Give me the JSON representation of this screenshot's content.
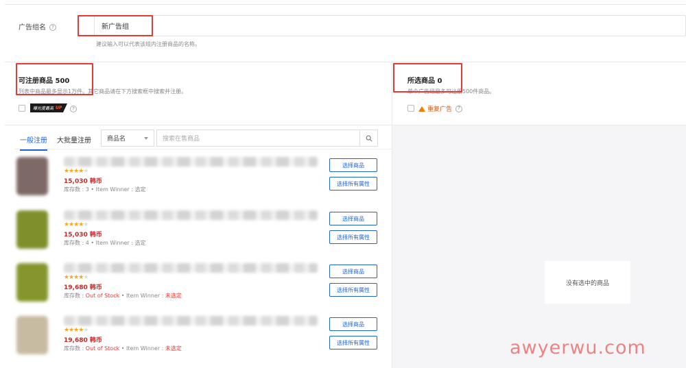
{
  "group": {
    "label": "广告组名",
    "help": "?",
    "value": "新广告组",
    "hint": "建议输入可以代表该组内注册商品的名称。"
  },
  "available": {
    "title": "可注册商品 500",
    "subtitle": "列表中商品最多显示1万件。其它商品请在下方搜索框中搜索并注册。",
    "badge_text": "曝光度最高",
    "badge_up": "UP",
    "help": "?"
  },
  "selected": {
    "title": "所选商品 0",
    "subtitle": "单个广告组最多可注册500件商品。",
    "warning": "重复广告",
    "help": "?",
    "empty_text": "没有选中的商品"
  },
  "tabs": {
    "general": "一般注册",
    "bulk": "大批量注册"
  },
  "search": {
    "select_value": "商品名",
    "placeholder": "搜索在售商品"
  },
  "buttons": {
    "select": "选择商品",
    "select_all": "选择所有属性"
  },
  "products": [
    {
      "rating": 4,
      "price": "15,030 韩币",
      "stock_prefix": "库存数 : 3 • Item Winner : ",
      "stock_status": "",
      "winner": "选定",
      "winner_red": false,
      "thumb": "#7d6a66"
    },
    {
      "rating": 4,
      "price": "15,030 韩币",
      "stock_prefix": "库存数 : 4 • Item Winner : ",
      "stock_status": "",
      "winner": "选定",
      "winner_red": false,
      "thumb": "#7f8f2c"
    },
    {
      "rating": 4,
      "price": "19,680 韩币",
      "stock_prefix": "库存数 : ",
      "stock_status": "Out of Stock",
      "stock_mid": " • Item Winner : ",
      "winner": "未选定",
      "winner_red": true,
      "thumb": "#86952c"
    },
    {
      "rating": 4,
      "price": "19,680 韩币",
      "stock_prefix": "库存数 : ",
      "stock_status": "Out of Stock",
      "stock_mid": " • Item Winner : ",
      "winner": "未选定",
      "winner_red": true,
      "thumb": "#c7bba1"
    }
  ],
  "watermark": "awyerwu.com",
  "colors": {
    "primary": "#1e63d6",
    "price": "#c62828",
    "highlight": "#e53935",
    "star": "#f5a623"
  }
}
